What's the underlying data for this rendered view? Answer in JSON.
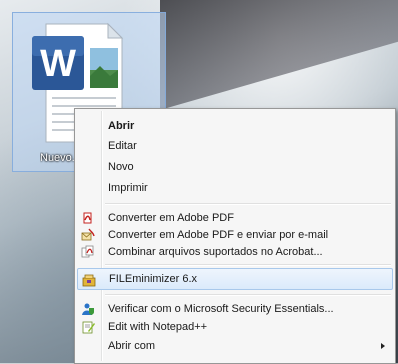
{
  "desktop_icon": {
    "label": "Nuevo..."
  },
  "context_menu": {
    "items": [
      {
        "label": "Abrir",
        "icon": null
      },
      {
        "label": "Editar",
        "icon": null
      },
      {
        "label": "Novo",
        "icon": null
      },
      {
        "label": "Imprimir",
        "icon": null
      },
      {
        "label": "Converter em Adobe PDF",
        "icon": "adobe-pdf-icon"
      },
      {
        "label": "Converter em Adobe PDF e enviar por e-mail",
        "icon": "adobe-pdf-email-icon"
      },
      {
        "label": "Combinar arquivos suportados no Acrobat...",
        "icon": "acrobat-combine-icon"
      },
      {
        "label": "FILEminimizer 6.x",
        "icon": "fileminimizer-icon"
      },
      {
        "label": "Verificar com o Microsoft Security Essentials...",
        "icon": "security-essentials-icon"
      },
      {
        "label": "Edit with Notepad++",
        "icon": "notepadpp-icon"
      },
      {
        "label": "Abrir com",
        "icon": null
      }
    ]
  },
  "colors": {
    "menu_bg": "#f6f6f6",
    "hover_border": "#a8c8eb",
    "word_blue": "#2b5797",
    "pdf_red": "#c4221f"
  }
}
